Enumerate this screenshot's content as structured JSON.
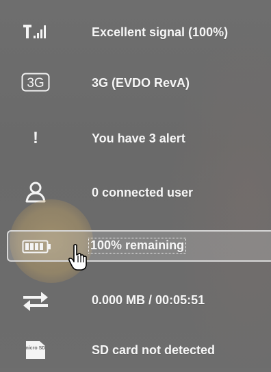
{
  "status_items": [
    {
      "icon": "signal-bars-icon",
      "label": "Excellent signal (100%)"
    },
    {
      "icon": "3g-icon",
      "icon_text": "3G",
      "label": "3G (EVDO RevA)"
    },
    {
      "icon": "exclamation-icon",
      "icon_text": "!",
      "label": "You have 3 alert"
    },
    {
      "icon": "user-icon",
      "label": "0 connected user"
    },
    {
      "icon": "battery-icon",
      "label": "100% remaining",
      "battery_level": 1.0
    },
    {
      "icon": "transfer-arrows-icon",
      "label": "0.000 MB / 00:05:51"
    },
    {
      "icon": "microsd-icon",
      "icon_text": "micro SD",
      "label": "SD card not detected"
    }
  ],
  "colors": {
    "background": "#6d6d6d",
    "text": "#f6f6f6",
    "highlight_border": "#d7d7d7",
    "halo": "#c8aa6e"
  }
}
